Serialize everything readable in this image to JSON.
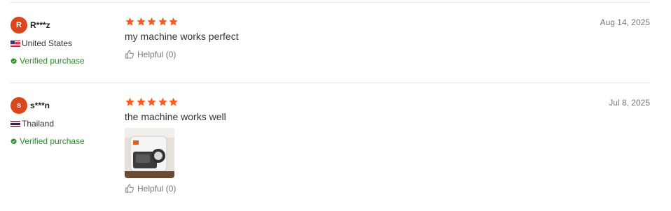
{
  "reviews": [
    {
      "avatar_letter": "R",
      "user_name": "R***z",
      "country": "United States",
      "verified_label": "Verified purchase",
      "rating": 5,
      "text": "my machine works perfect",
      "date": "Aug 14, 2025",
      "helpful_label": "Helpful (0)"
    },
    {
      "avatar_letter": "s",
      "user_name": "s***n",
      "country": "Thailand",
      "verified_label": "Verified purchase",
      "rating": 5,
      "text": "the machine works well",
      "date": "Jul 8, 2025",
      "helpful_label": "Helpful (0)",
      "has_photo": true
    }
  ],
  "colors": {
    "avatar_bg": "#d9471d",
    "star": "#ff5a1f",
    "verified": "#2e8b2e"
  },
  "icons": {
    "star": "star-icon",
    "verified": "verified-badge-icon",
    "helpful": "thumbs-up-icon",
    "flag_us": "us-flag-icon",
    "flag_th": "thailand-flag-icon"
  }
}
